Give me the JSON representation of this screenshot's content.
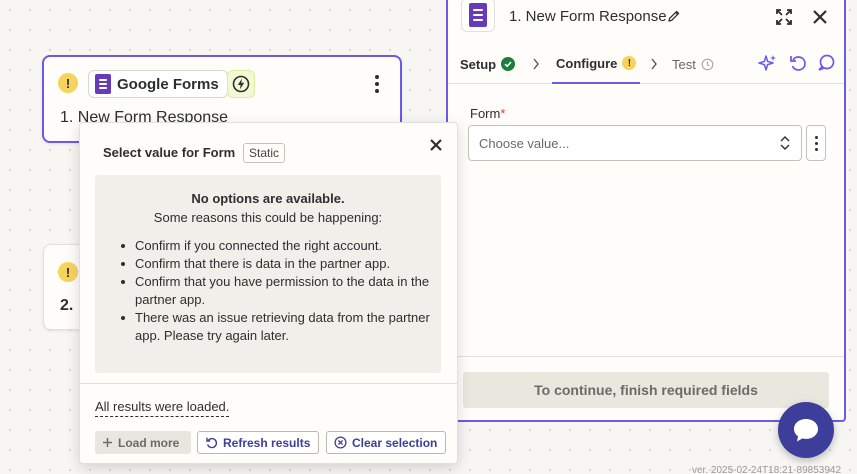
{
  "trigger_card": {
    "app_name": "Google Forms",
    "title": "1. New Form Response",
    "warning_glyph": "!"
  },
  "action_card": {
    "title": "2.",
    "warning_glyph": "!"
  },
  "panel": {
    "title": "1. New Form Response",
    "tabs": {
      "setup": "Setup",
      "configure": "Configure",
      "test": "Test"
    },
    "field_label": "Form",
    "required_marker": "*",
    "select_placeholder": "Choose value...",
    "continue_label": "To continue, finish required fields"
  },
  "popover": {
    "title": "Select value for Form",
    "tag": "Static",
    "no_options_heading": "No options are available.",
    "no_options_subheading": "Some reasons this could be happening:",
    "reasons": [
      "Confirm if you connected the right account.",
      "Confirm that there is data in the partner app.",
      "Confirm that you have permission to the data in the partner app.",
      "There was an issue retrieving data from the partner app. Please try again later."
    ],
    "loaded_status": "All results were loaded.",
    "buttons": {
      "load_more": "Load more",
      "refresh": "Refresh results",
      "clear": "Clear selection"
    }
  },
  "version": "ver. 2025-02-24T18:21-89853942",
  "colors": {
    "accent": "#695be8",
    "brand_dark": "#3d3d9a",
    "warning": "#f7d35c",
    "success": "#1b7f3b",
    "google_forms_purple": "#673ab7"
  }
}
